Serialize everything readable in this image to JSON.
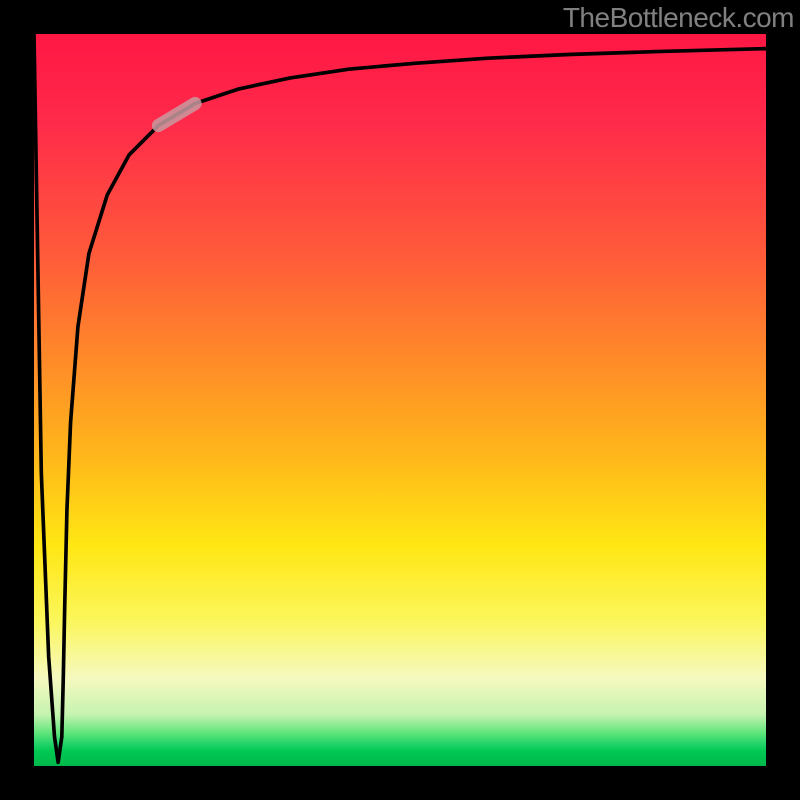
{
  "watermark": "TheBottleneck.com",
  "chart_data": {
    "type": "line",
    "title": "",
    "xlabel": "",
    "ylabel": "",
    "xlim": [
      0,
      1000
    ],
    "ylim": [
      0,
      1000
    ],
    "series": [
      {
        "name": "main-curve",
        "x": [
          0,
          5,
          10,
          20,
          28,
          33,
          38,
          40,
          42,
          45,
          50,
          60,
          75,
          100,
          130,
          170,
          220,
          280,
          350,
          430,
          520,
          620,
          730,
          850,
          1000
        ],
        "y": [
          1000,
          700,
          400,
          150,
          40,
          5,
          40,
          120,
          220,
          350,
          470,
          600,
          700,
          780,
          835,
          875,
          905,
          925,
          940,
          952,
          960,
          967,
          972,
          976,
          980
        ]
      }
    ],
    "highlight_segment": {
      "note": "thicker light segment on rising curve",
      "x_range": [
        170,
        275
      ],
      "y_range": [
        772,
        842
      ]
    },
    "gradient_stops": [
      {
        "pos": 0.0,
        "color": "#ff1744"
      },
      {
        "pos": 0.3,
        "color": "#ff5a3a"
      },
      {
        "pos": 0.58,
        "color": "#ffb81a"
      },
      {
        "pos": 0.8,
        "color": "#fbf65a"
      },
      {
        "pos": 0.95,
        "color": "#5ee57a"
      },
      {
        "pos": 1.0,
        "color": "#00b84a"
      }
    ]
  }
}
